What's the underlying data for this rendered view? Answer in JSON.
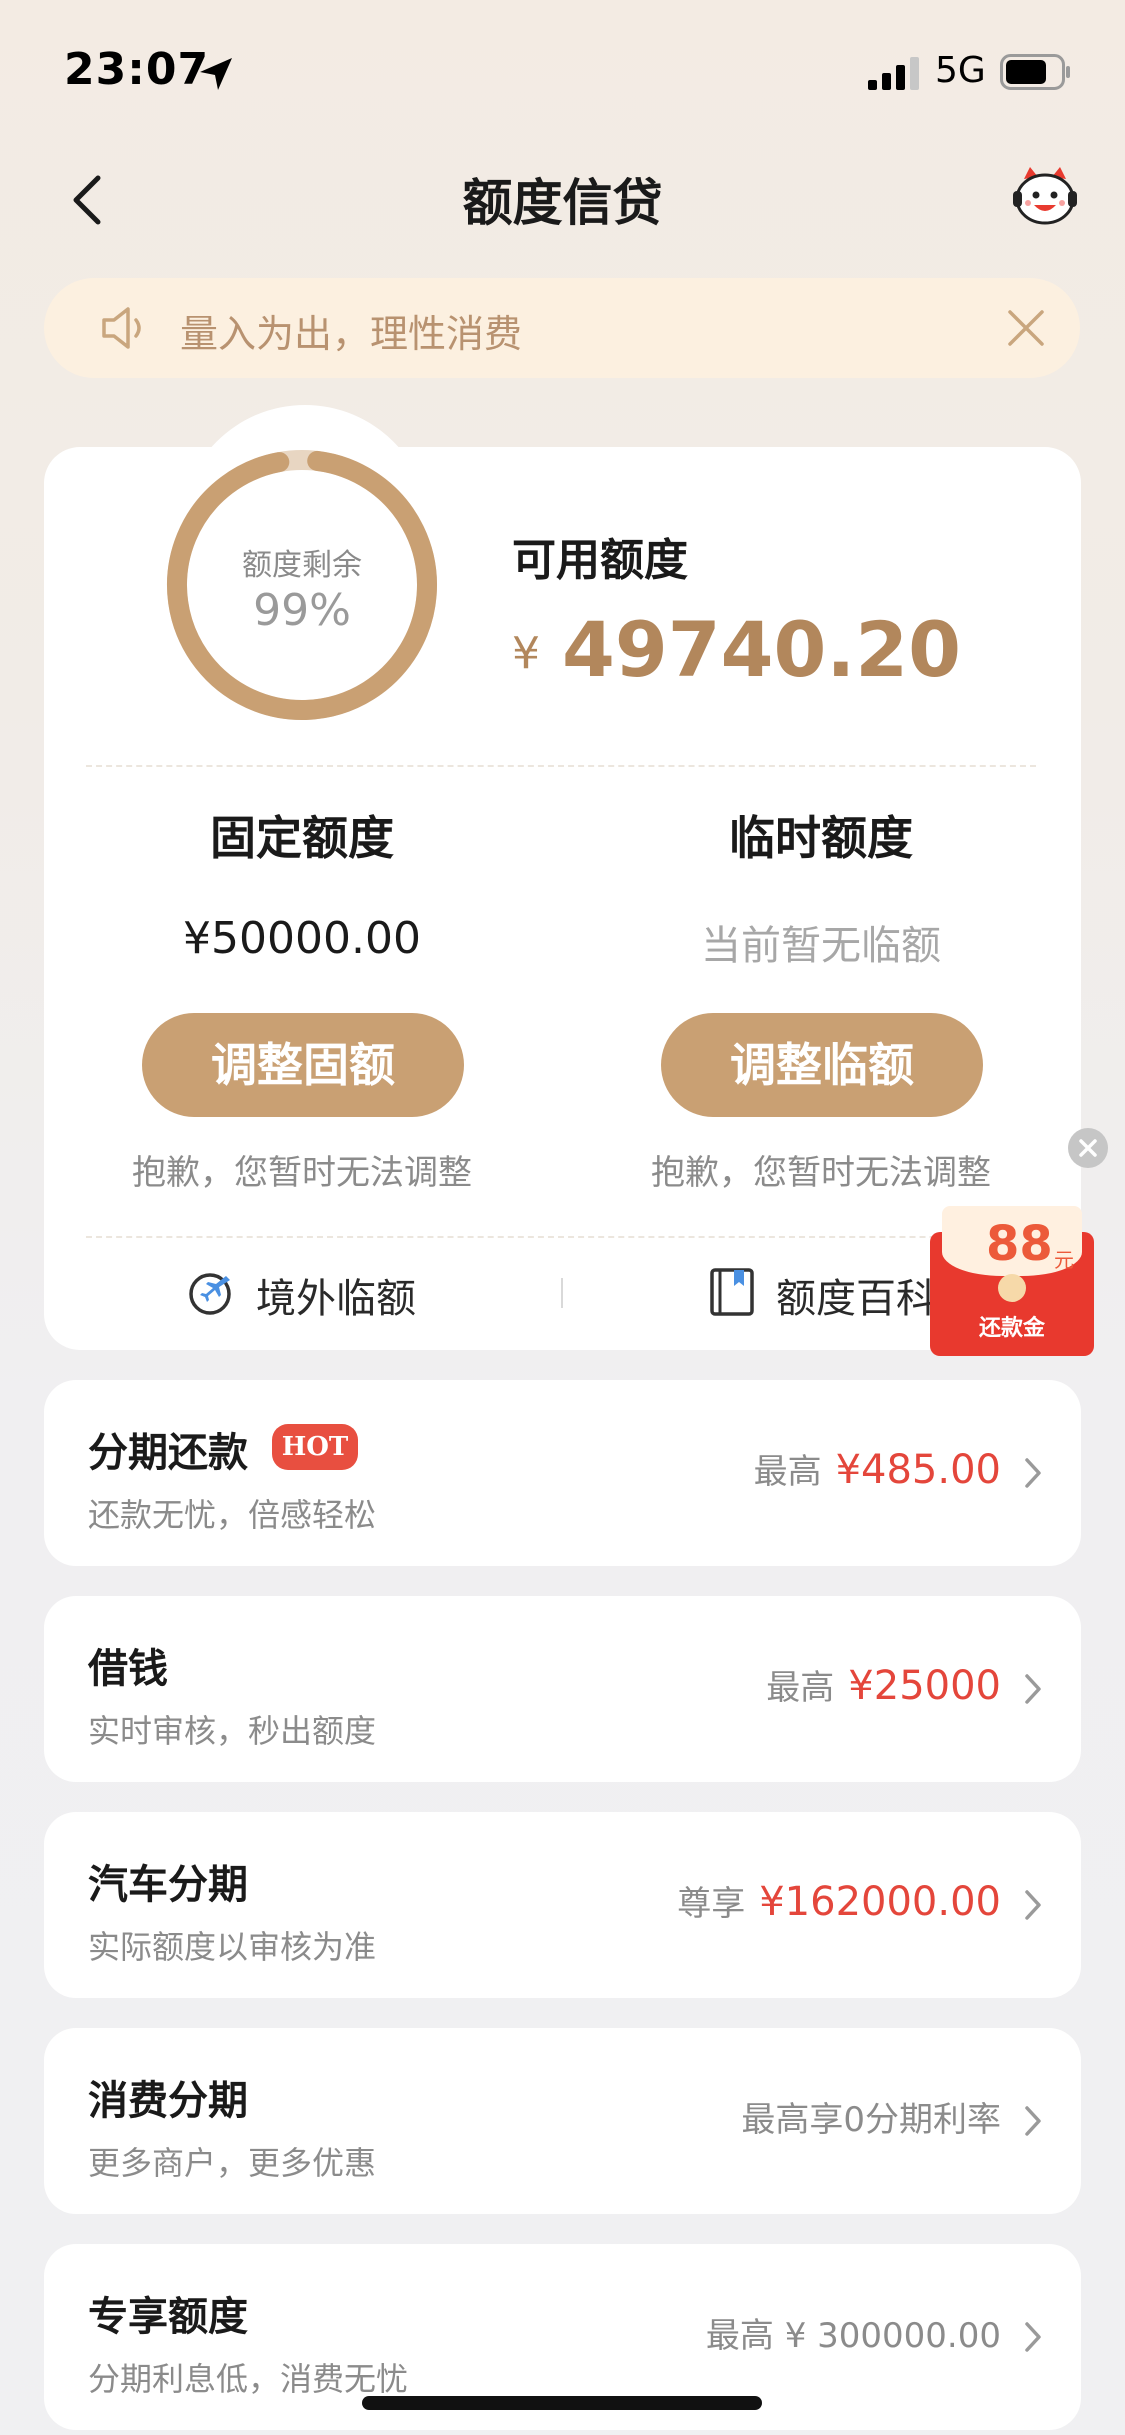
{
  "status": {
    "time": "23:07",
    "network": "5G"
  },
  "nav": {
    "title": "额度信贷"
  },
  "notice": {
    "text": "量入为出，理性消费"
  },
  "credit": {
    "ring_label": "额度剩余",
    "ring_percent": "99%",
    "remaining_fraction": 0.99,
    "available_label": "可用额度",
    "currency": "¥",
    "available_value": "49740.20",
    "fixed": {
      "title": "固定额度",
      "value": "¥50000.00",
      "button": "调整固额",
      "note": "抱歉，您暂时无法调整"
    },
    "temp": {
      "title": "临时额度",
      "value": "当前暂无临额",
      "button": "调整临额",
      "note": "抱歉，您暂时无法调整"
    },
    "links": {
      "overseas": "境外临额",
      "encyclopedia": "额度百科"
    }
  },
  "promo": {
    "amount": "88",
    "unit": "元",
    "label": "还款金"
  },
  "items": [
    {
      "title": "分期还款",
      "badge": "HOT",
      "subtitle": "还款无忧，倍感轻松",
      "prefix": "最高",
      "amount": "¥485.00"
    },
    {
      "title": "借钱",
      "subtitle": "实时审核，秒出额度",
      "prefix": "最高",
      "amount": "¥25000"
    },
    {
      "title": "汽车分期",
      "subtitle": "实际额度以审核为准",
      "prefix": "尊享",
      "amount": "¥162000.00"
    },
    {
      "title": "消费分期",
      "subtitle": "更多商户，更多优惠",
      "right_text": "最高享0分期利率"
    },
    {
      "title": "专享额度",
      "subtitle": "分期利息低，消费无忧",
      "right_text": "最高 ¥ 300000.00"
    }
  ],
  "colors": {
    "accent": "#c9a073",
    "amount_red": "#e4463b",
    "gold_text": "#b2875c"
  }
}
